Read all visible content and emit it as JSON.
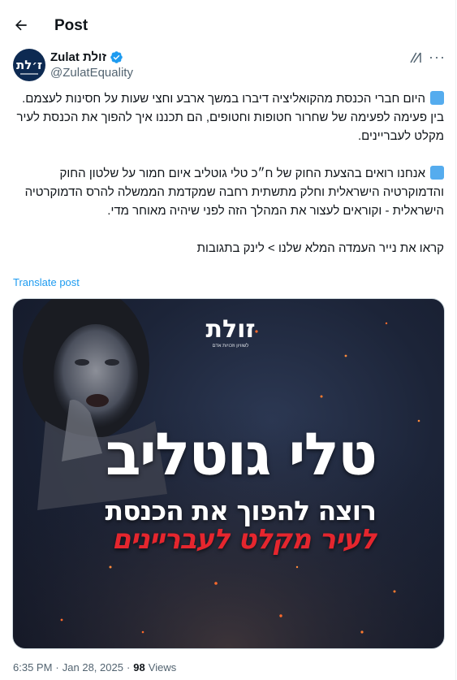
{
  "header": {
    "title": "Post",
    "back_icon": "arrow-left-icon"
  },
  "author": {
    "display_name": "Zulat זולת",
    "handle": "@ZulatEquality",
    "avatar_text": "ז׳לת",
    "verified": true,
    "verified_color": "#1d9bf0"
  },
  "actions": {
    "grok_icon": "grok-icon",
    "more_label": "···"
  },
  "tweet": {
    "paragraphs": [
      "היום חברי הכנסת מהקואליציה דיברו במשך ארבע וחצי שעות על חסינות לעצמם. בין פעימה לפעימה של שחרור חטופות וחטופים, הם תכננו איך להפוך את הכנסת לעיר מקלט לעבריינים.",
      "אנחנו רואים בהצעת החוק של ח״כ טלי גוטליב איום חמור על שלטון החוק והדמוקרטיה הישראלית וחלק מתשתית רחבה שמקדמת הממשלה להרס הדמוקרטיה הישראלית - וקוראים לעצור את המהלך הזה לפני שיהיה מאוחר מדי.",
      "קראו את נייר העמדה המלא שלנו > לינק בתגובות"
    ],
    "translate_label": "Translate post",
    "bullet_color": "#55acee"
  },
  "media": {
    "brand_logo": "זולת",
    "brand_sub": "לשוויון וזכויות אדם",
    "headline_main": "טלי גוטליב",
    "headline_sub": "רוצה להפוך את הכנסת",
    "headline_red": "לעיר מקלט לעבריינים",
    "accent_red": "#e5262e"
  },
  "meta": {
    "time": "6:35 PM",
    "separator": "·",
    "date": "Jan 28, 2025",
    "views_count": "98",
    "views_label": "Views"
  }
}
